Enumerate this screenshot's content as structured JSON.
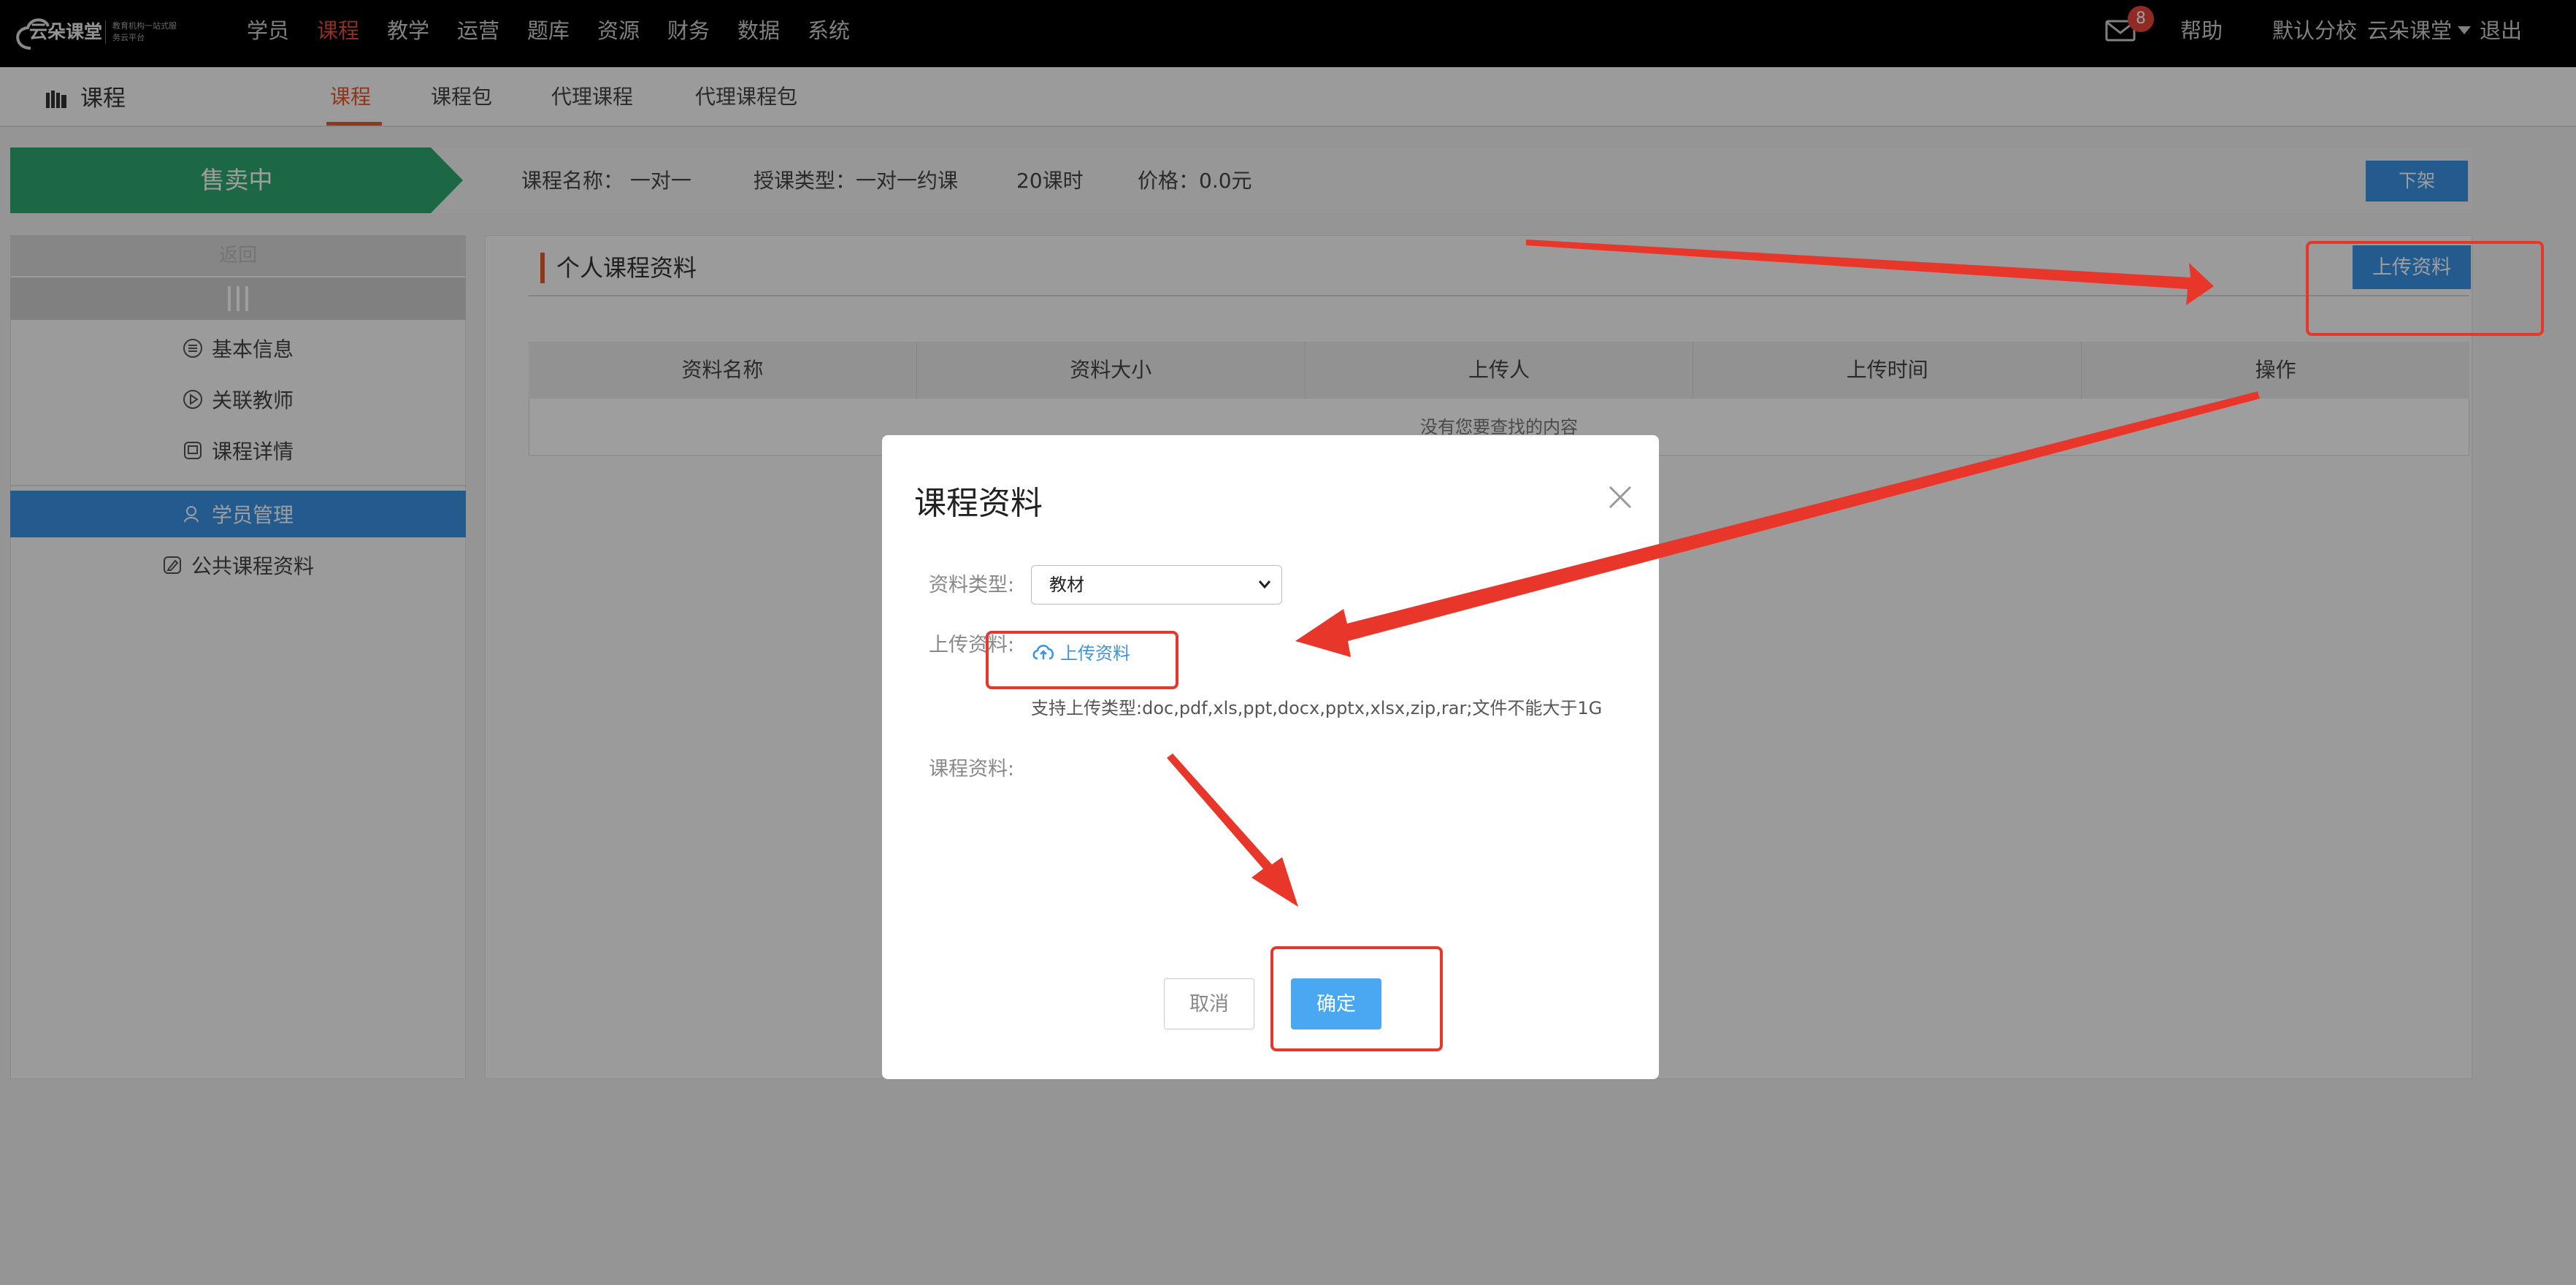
{
  "topnav": {
    "logo_text": "云朵课堂",
    "logo_slogan": "教育机构一站式服务云平台",
    "items": [
      "学员",
      "课程",
      "教学",
      "运营",
      "题库",
      "资源",
      "财务",
      "数据",
      "系统"
    ],
    "active_item": "课程",
    "mail_count": "8",
    "help": "帮助",
    "branch": "默认分校",
    "account": "云朵课堂",
    "logout": "退出"
  },
  "subnav": {
    "title": "课程",
    "tabs": [
      "课程",
      "课程包",
      "代理课程",
      "代理课程包"
    ],
    "active_tab": "课程"
  },
  "status": {
    "badge": "售卖中",
    "course_name": "课程名称： 一对一",
    "lesson_type": "授课类型：一对一约课",
    "hours": "20课时",
    "price": "价格：0.0元",
    "offshelf_button": "下架"
  },
  "sidebar": {
    "back": "返回",
    "items": [
      {
        "label": "基本信息",
        "icon": "list-circle-icon"
      },
      {
        "label": "关联教师",
        "icon": "play-circle-icon"
      },
      {
        "label": "课程详情",
        "icon": "document-icon"
      },
      {
        "label": "学员管理",
        "icon": "user-icon",
        "active": true
      },
      {
        "label": "公共课程资料",
        "icon": "edit-icon"
      }
    ]
  },
  "panel": {
    "title": "个人课程资料",
    "upload_button": "上传资料",
    "columns": [
      "资料名称",
      "资料大小",
      "上传人",
      "上传时间",
      "操作"
    ],
    "empty_text": "没有您要查找的内容"
  },
  "modal": {
    "title": "课程资料",
    "type_label": "资料类型:",
    "type_value": "教材",
    "upload_label": "上传资料:",
    "upload_link": "上传资料",
    "support_text": "支持上传类型:doc,pdf,xls,ppt,docx,pptx,xlsx,zip,rar;文件不能大于1G",
    "materials_label": "课程资料:",
    "cancel": "取消",
    "confirm": "确定"
  },
  "colors": {
    "accent": "#e84c3d",
    "primary": "#3a93e6",
    "selling": "#2fa96e",
    "annotation": "#e8372a"
  }
}
